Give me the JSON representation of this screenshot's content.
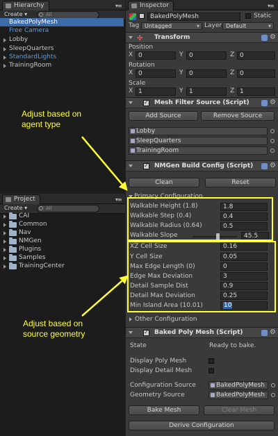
{
  "hierarchy": {
    "tab_label": "Hierarchy",
    "create_label": "Create ▾",
    "search_placeholder": "All",
    "items": [
      {
        "label": "BakedPolyMesh"
      },
      {
        "label": "Free Camera"
      },
      {
        "label": "Lobby"
      },
      {
        "label": "SleepQuarters"
      },
      {
        "label": "StandardLights"
      },
      {
        "label": "TrainingRoom"
      }
    ]
  },
  "project": {
    "tab_label": "Project",
    "create_label": "Create ▾",
    "search_placeholder": "All",
    "folders": [
      {
        "label": "CAI"
      },
      {
        "label": "Common"
      },
      {
        "label": "Nav"
      },
      {
        "label": "NMGen"
      },
      {
        "label": "Plugins"
      },
      {
        "label": "Samples"
      },
      {
        "label": "TrainingCenter"
      }
    ]
  },
  "inspector": {
    "tab_label": "Inspector",
    "object_name": "BakedPolyMesh",
    "static_label": "Static",
    "tag_label": "Tag",
    "tag_value": "Untagged",
    "layer_label": "Layer",
    "layer_value": "Default",
    "transform": {
      "title": "Transform",
      "position_label": "Position",
      "rotation_label": "Rotation",
      "scale_label": "Scale",
      "x_label": "X",
      "y_label": "Y",
      "z_label": "Z",
      "position": [
        "0",
        "0",
        "0"
      ],
      "rotation": [
        "0",
        "0",
        "0"
      ],
      "scale": [
        "1",
        "1",
        "1"
      ]
    },
    "mesh_filter": {
      "title": "Mesh Filter Source (Script)",
      "add_label": "Add Source",
      "remove_label": "Remove Source",
      "sources": [
        "Lobby",
        "SleepQuarters",
        "TrainingRoom"
      ]
    },
    "build_config": {
      "title": "NMGen Build Config (Script)",
      "clean_label": "Clean",
      "reset_label": "Reset",
      "primary_label": "Primary Configuration",
      "rows_agent": [
        {
          "label": "Walkable Height  (1.8)",
          "value": "1.8"
        },
        {
          "label": "Walkable Step  (0.4)",
          "value": "0.4"
        },
        {
          "label": "Walkable Radius  (0.64)",
          "value": "0.5"
        },
        {
          "label": "Walkable Slope",
          "value": "45.5"
        }
      ],
      "rows_geometry": [
        {
          "label": "XZ Cell Size",
          "value": "0.16"
        },
        {
          "label": "Y Cell Size",
          "value": "0.05"
        },
        {
          "label": "Max Edge Length  (0)",
          "value": "0"
        },
        {
          "label": "Edge Max Deviation",
          "value": "3"
        },
        {
          "label": "Detail Sample Dist",
          "value": "0.9"
        },
        {
          "label": "Detail Max Deviation",
          "value": "0.25"
        },
        {
          "label": "Min Island Area  (10.01)",
          "value": "10"
        }
      ],
      "other_label": "Other Configuration"
    },
    "baked_mesh": {
      "title": "Baked Poly Mesh (Script)",
      "state_label": "State",
      "state_value": "Ready to bake.",
      "display_poly_label": "Display Poly Mesh",
      "display_detail_label": "Display Detail Mesh",
      "config_source_label": "Configuration Source",
      "config_source_value": "BakedPolyMesh",
      "geometry_source_label": "Geometry Source",
      "geometry_source_value": "BakedPolyMesh",
      "bake_label": "Bake Mesh",
      "clear_label": "Clear Mesh",
      "derive_label": "Derive Configuration"
    }
  },
  "annotations": {
    "agent_note": "Adjust based on agent type",
    "geometry_note": "Adjust based on source geometry"
  },
  "colors": {
    "annotation": "#ffff33",
    "selection": "#3d6aa8",
    "prefab_blue": "#5a9be6"
  }
}
